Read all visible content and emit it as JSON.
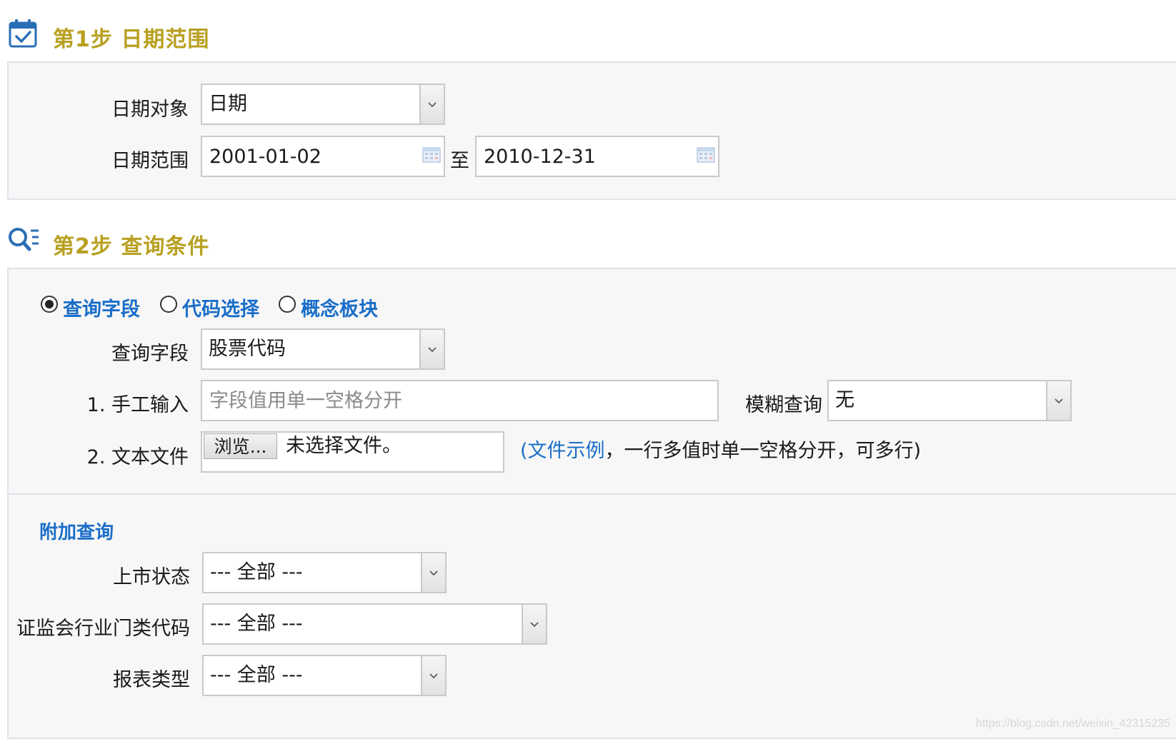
{
  "step1": {
    "title": "第1步 日期范围",
    "date_object_label": "日期对象",
    "date_object_value": "日期",
    "date_range_label": "日期范围",
    "date_from": "2001-01-02",
    "separator": "至",
    "date_to": "2010-12-31"
  },
  "step2": {
    "title": "第2步 查询条件",
    "radios": [
      {
        "label": "查询字段",
        "checked": true
      },
      {
        "label": "代码选择",
        "checked": false
      },
      {
        "label": "概念板块",
        "checked": false
      }
    ],
    "query_field_label": "查询字段",
    "query_field_value": "股票代码",
    "manual_input_label": "1. 手工输入",
    "manual_input_placeholder": "字段值用单一空格分开",
    "fuzzy_label": "模糊查询",
    "fuzzy_value": "无",
    "text_file_label": "2. 文本文件",
    "browse_button": "浏览...",
    "no_file_text": "未选择文件。",
    "hint_open": "(",
    "hint_link": "文件示例",
    "hint_rest": "，一行多值时单一空格分开，可多行)",
    "extra_title": "附加查询",
    "listing_status_label": "上市状态",
    "listing_status_value": "--- 全部 ---",
    "industry_label": "证监会行业门类代码",
    "industry_value": "--- 全部 ---",
    "report_type_label": "报表类型",
    "report_type_value": "--- 全部 ---"
  },
  "watermark": "https://blog.csdn.net/weixin_42315235",
  "colors": {
    "step_title": "#b8a020",
    "link_blue": "#1a6ec8",
    "panel_bg": "#f7f7f7",
    "icon_blue": "#2a6fb5"
  }
}
